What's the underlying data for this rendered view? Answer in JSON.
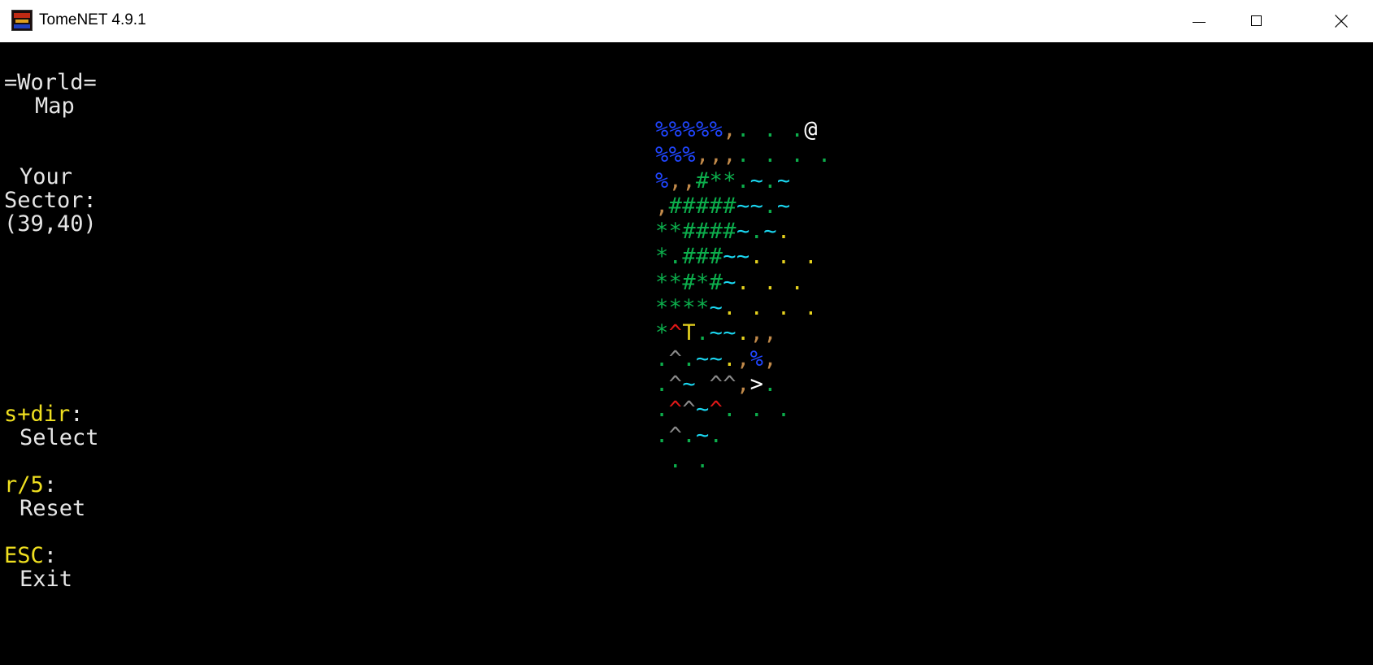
{
  "window": {
    "title": "TomeNET 4.9.1",
    "icon": "tomenet-app-icon"
  },
  "sidebar": {
    "header_line1": "=World=",
    "header_line2": "Map",
    "sector_line1": "Your",
    "sector_line2": "Sector:",
    "sector_coords": "(39,40)",
    "controls": [
      {
        "key": "s+dir",
        "colon": ":",
        "action": "Select"
      },
      {
        "key": "r/5",
        "colon": ":",
        "action": "Reset"
      },
      {
        "key": "ESC",
        "colon": ":",
        "action": "Exit"
      }
    ]
  },
  "map": {
    "colors": {
      "b": "#2046ff",
      "y": "#e6d21e",
      "bn": "#c28a4a",
      "g": "#0cae4c",
      "c": "#1ad6f0",
      "w": "#ffffff",
      "gr": "#8a8a8a",
      "r": "#e01818"
    },
    "rows": [
      [
        [
          "%%%%%",
          "b"
        ],
        [
          ",",
          "bn"
        ],
        [
          ". . .",
          "g"
        ],
        [
          "@",
          "w"
        ]
      ],
      [
        [
          "%%%",
          "b"
        ],
        [
          ",",
          "bn"
        ],
        [
          ",",
          "bn"
        ],
        [
          ",",
          "bn"
        ],
        [
          ". . . .",
          "g"
        ]
      ],
      [
        [
          "%",
          "b"
        ],
        [
          ",",
          "bn"
        ],
        [
          ",",
          "bn"
        ],
        [
          "#",
          "g"
        ],
        [
          "**",
          "g"
        ],
        [
          ".",
          "g"
        ],
        [
          "~",
          "c"
        ],
        [
          ".",
          "g"
        ],
        [
          "~",
          "c"
        ]
      ],
      [
        [
          ",",
          "bn"
        ],
        [
          "#####",
          "g"
        ],
        [
          "~~",
          "c"
        ],
        [
          ".",
          "g"
        ],
        [
          "~",
          "c"
        ]
      ],
      [
        [
          "**",
          "g"
        ],
        [
          "####",
          "g"
        ],
        [
          "~",
          "c"
        ],
        [
          ".",
          "g"
        ],
        [
          "~",
          "c"
        ],
        [
          ".",
          "y"
        ]
      ],
      [
        [
          "*",
          "g"
        ],
        [
          ".",
          "g"
        ],
        [
          "###",
          "g"
        ],
        [
          "~~",
          "c"
        ],
        [
          ". . .",
          "y"
        ]
      ],
      [
        [
          "**",
          "g"
        ],
        [
          "#",
          "g"
        ],
        [
          "*",
          "g"
        ],
        [
          "#",
          "g"
        ],
        [
          "~",
          "c"
        ],
        [
          ". . .",
          "y"
        ]
      ],
      [
        [
          "****",
          "g"
        ],
        [
          "~",
          "c"
        ],
        [
          ". . . .",
          "y"
        ]
      ],
      [
        [
          "*",
          "g"
        ],
        [
          "^",
          "r"
        ],
        [
          "T",
          "y"
        ],
        [
          ".",
          "g"
        ],
        [
          "~~",
          "c"
        ],
        [
          ".",
          "y"
        ],
        [
          ",",
          "bn"
        ],
        [
          ",",
          "bn"
        ]
      ],
      [
        [
          ".",
          "g"
        ],
        [
          "^",
          "gr"
        ],
        [
          ".",
          "g"
        ],
        [
          "~~",
          "c"
        ],
        [
          ".",
          "y"
        ],
        [
          ",",
          "bn"
        ],
        [
          "%",
          "b"
        ],
        [
          ",",
          "bn"
        ]
      ],
      [
        [
          ".",
          "g"
        ],
        [
          "^",
          "gr"
        ],
        [
          "~",
          "c"
        ],
        [
          " ",
          "g"
        ],
        [
          "^^",
          "gr"
        ],
        [
          ",",
          "bn"
        ],
        [
          ">",
          "w"
        ],
        [
          ".",
          "g"
        ]
      ],
      [
        [
          ".",
          "g"
        ],
        [
          "^",
          "r"
        ],
        [
          "^",
          "gr"
        ],
        [
          "~",
          "c"
        ],
        [
          "^",
          "r"
        ],
        [
          ". . .",
          "g"
        ]
      ],
      [
        [
          ".",
          "g"
        ],
        [
          "^",
          "gr"
        ],
        [
          ".",
          "g"
        ],
        [
          "~",
          "c"
        ],
        [
          ".",
          "g"
        ]
      ],
      [
        [
          " . .",
          "g"
        ]
      ]
    ]
  }
}
